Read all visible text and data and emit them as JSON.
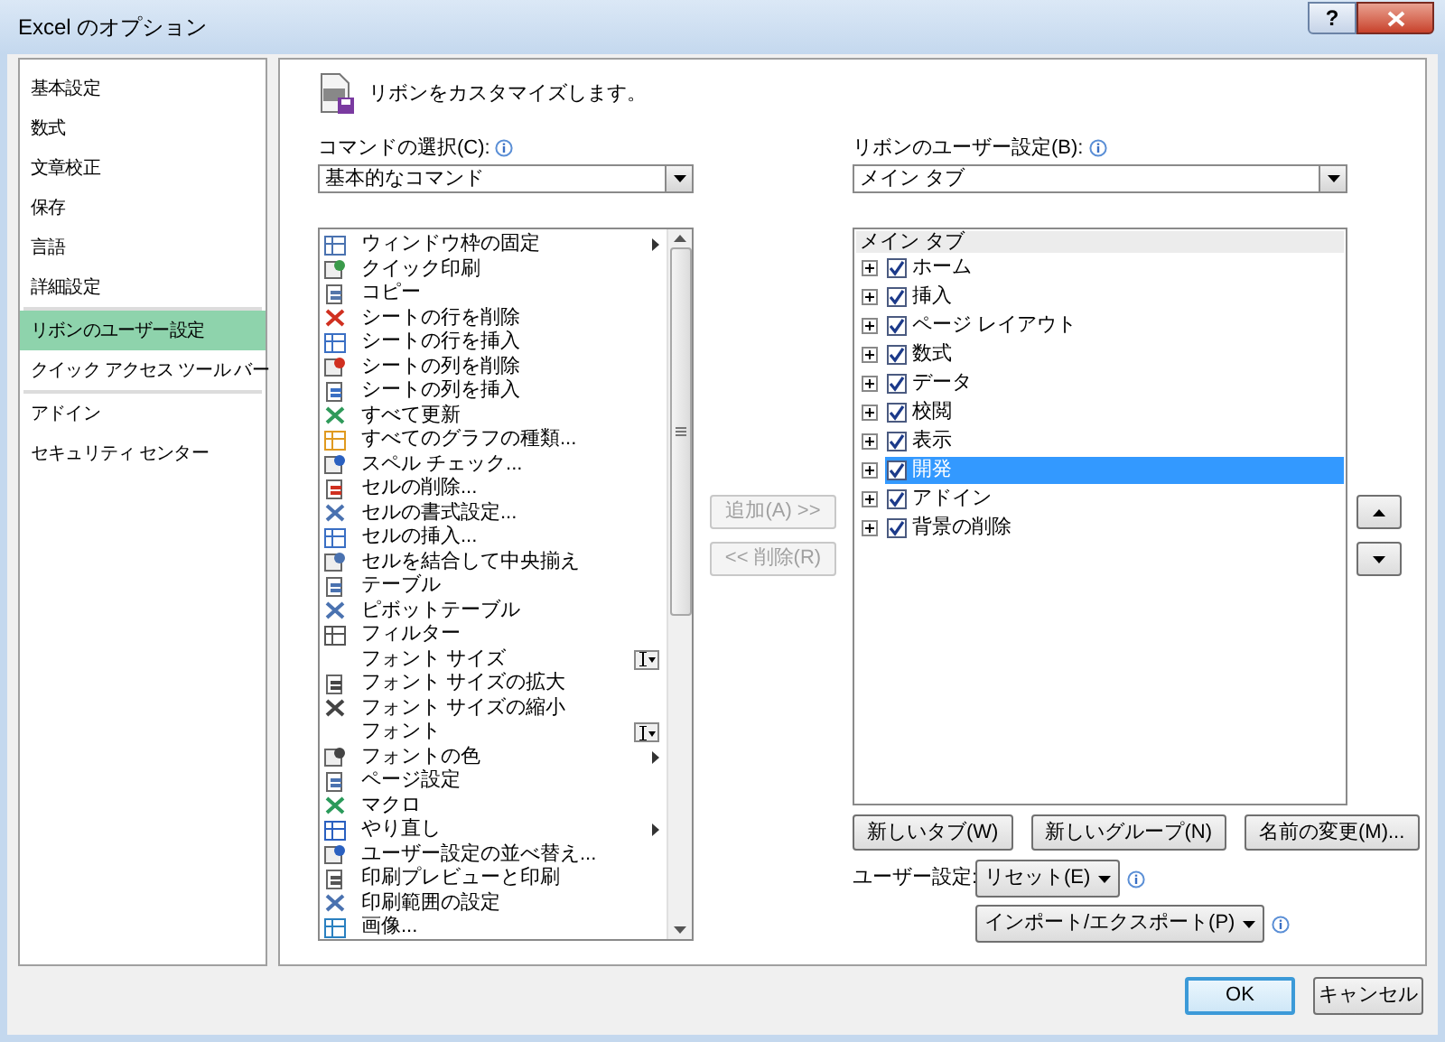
{
  "window": {
    "title": "Excel のオプション",
    "help": "?"
  },
  "sidebar": {
    "items": [
      {
        "label": "基本設定",
        "selected": false
      },
      {
        "label": "数式",
        "selected": false
      },
      {
        "label": "文章校正",
        "selected": false
      },
      {
        "label": "保存",
        "selected": false
      },
      {
        "label": "言語",
        "selected": false
      },
      {
        "label": "詳細設定",
        "selected": false
      },
      {
        "label": "リボンのユーザー設定",
        "selected": true
      },
      {
        "label": "クイック アクセス ツール バー",
        "selected": false
      },
      {
        "label": "アドイン",
        "selected": false
      },
      {
        "label": "セキュリティ センター",
        "selected": false
      }
    ]
  },
  "header": "リボンをカスタマイズします。",
  "commands": {
    "label": "コマンドの選択(C):",
    "value": "基本的なコマンド",
    "items": [
      {
        "label": "ウィンドウ枠の固定",
        "kind": "submenu"
      },
      {
        "label": "クイック印刷",
        "kind": "plain"
      },
      {
        "label": "コピー",
        "kind": "plain"
      },
      {
        "label": "シートの行を削除",
        "kind": "plain"
      },
      {
        "label": "シートの行を挿入",
        "kind": "plain"
      },
      {
        "label": "シートの列を削除",
        "kind": "plain"
      },
      {
        "label": "シートの列を挿入",
        "kind": "plain"
      },
      {
        "label": "すべて更新",
        "kind": "plain"
      },
      {
        "label": "すべてのグラフの種類...",
        "kind": "plain"
      },
      {
        "label": "スペル チェック...",
        "kind": "plain"
      },
      {
        "label": "セルの削除...",
        "kind": "plain"
      },
      {
        "label": "セルの書式設定...",
        "kind": "plain"
      },
      {
        "label": "セルの挿入...",
        "kind": "plain"
      },
      {
        "label": "セルを結合して中央揃え",
        "kind": "plain"
      },
      {
        "label": "テーブル",
        "kind": "plain"
      },
      {
        "label": "ピボットテーブル",
        "kind": "plain"
      },
      {
        "label": "フィルター",
        "kind": "plain"
      },
      {
        "label": "フォント サイズ",
        "kind": "dropdown"
      },
      {
        "label": "フォント サイズの拡大",
        "kind": "plain"
      },
      {
        "label": "フォント サイズの縮小",
        "kind": "plain"
      },
      {
        "label": "フォント",
        "kind": "dropdown"
      },
      {
        "label": "フォントの色",
        "kind": "submenu"
      },
      {
        "label": "ページ設定",
        "kind": "plain"
      },
      {
        "label": "マクロ",
        "kind": "plain"
      },
      {
        "label": "やり直し",
        "kind": "submenu"
      },
      {
        "label": "ユーザー設定の並べ替え...",
        "kind": "plain"
      },
      {
        "label": "印刷プレビューと印刷",
        "kind": "plain"
      },
      {
        "label": "印刷範囲の設定",
        "kind": "plain"
      },
      {
        "label": "画像...",
        "kind": "plain"
      }
    ]
  },
  "add_button": {
    "label": "追加(A) >>",
    "disabled": true
  },
  "remove_button": {
    "label": "<< 削除(R)",
    "disabled": true
  },
  "ribbon": {
    "label": "リボンのユーザー設定(B):",
    "value": "メイン タブ",
    "header": "メイン タブ",
    "items": [
      {
        "label": "ホーム",
        "checked": true,
        "selected": false
      },
      {
        "label": "挿入",
        "checked": true,
        "selected": false
      },
      {
        "label": "ページ レイアウト",
        "checked": true,
        "selected": false
      },
      {
        "label": "数式",
        "checked": true,
        "selected": false
      },
      {
        "label": "データ",
        "checked": true,
        "selected": false
      },
      {
        "label": "校閲",
        "checked": true,
        "selected": false
      },
      {
        "label": "表示",
        "checked": true,
        "selected": false
      },
      {
        "label": "開発",
        "checked": true,
        "selected": true
      },
      {
        "label": "アドイン",
        "checked": true,
        "selected": false
      },
      {
        "label": "背景の削除",
        "checked": true,
        "selected": false
      }
    ]
  },
  "tab_buttons": [
    "新しいタブ(W)",
    "新しいグループ(N)",
    "名前の変更(M)..."
  ],
  "user_settings": {
    "label": "ユーザー設定:",
    "reset": "リセット(E)",
    "import_export": "インポート/エクスポート(P)"
  },
  "footer_buttons": [
    {
      "label": "OK",
      "default": true
    },
    {
      "label": "キャンセル",
      "default": false
    }
  ]
}
